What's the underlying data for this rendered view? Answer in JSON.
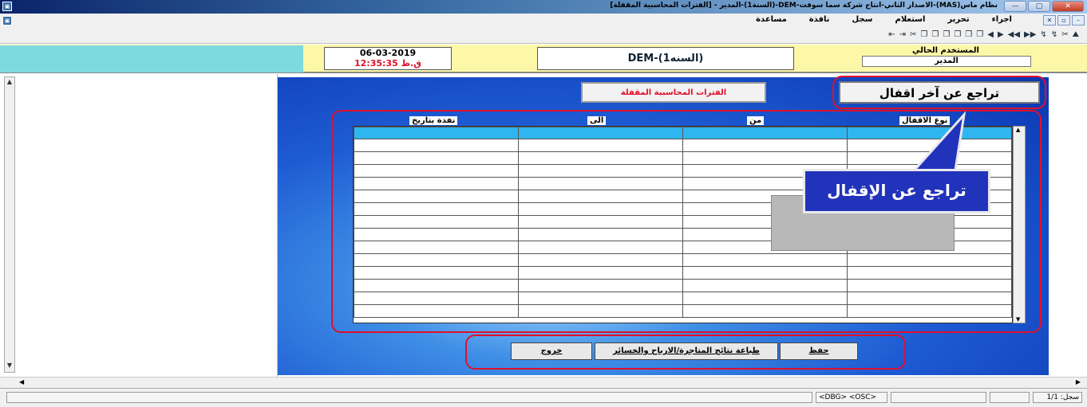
{
  "window": {
    "title": "نظام ماس(MAS)-الاصدار الثاني-انتاج شركة سما سوفت-DEM-(السنة1)-المدير - [الفترات المحاسبية المقفلة]",
    "buttons": {
      "minimize": "—",
      "maximize": "▢",
      "close": "✕"
    }
  },
  "menu": {
    "items": [
      "اجراء",
      "تحرير",
      "استعلام",
      "سجل",
      "نافذة",
      "مساعدة"
    ],
    "mdi_buttons": {
      "close": "✕",
      "restore": "▫",
      "minimize": "–"
    }
  },
  "toolbar": {
    "glyphs": [
      "⇤",
      "⇥",
      "✂",
      "❐",
      "❐",
      "❐",
      "❐",
      "❐",
      "❐",
      "◀",
      "▶",
      "◀◀",
      "▶▶",
      "↯",
      "↯",
      "✂",
      "⛰"
    ]
  },
  "header": {
    "date": "06-03-2019",
    "time": "12:35:35 ق.ظ",
    "company_year": "DEM-(السنه1)",
    "current_user_label": "المستخدم الحالي",
    "current_user": "المدير"
  },
  "form": {
    "title_button": "الفترات المحاسبية المقفلة",
    "undo_button": "تراجع عن آخر اقفال",
    "columns": [
      "نوع الاقفال",
      "من",
      "الى",
      "نفذة بتاريخ"
    ],
    "callout": "تراجع عن الإقفال",
    "buttons": {
      "save": "حفظ",
      "print": "طباعة نتائج المتاجرة/الارباح والخسائر",
      "exit": "خروج"
    }
  },
  "statusbar": {
    "record": "سجل: 1/1",
    "dbg": "<DBG> <OSC>"
  },
  "colors": {
    "accent_red": "#e0102a",
    "grid_header": "#2fb6f0",
    "callout_bg": "#2233bb"
  }
}
